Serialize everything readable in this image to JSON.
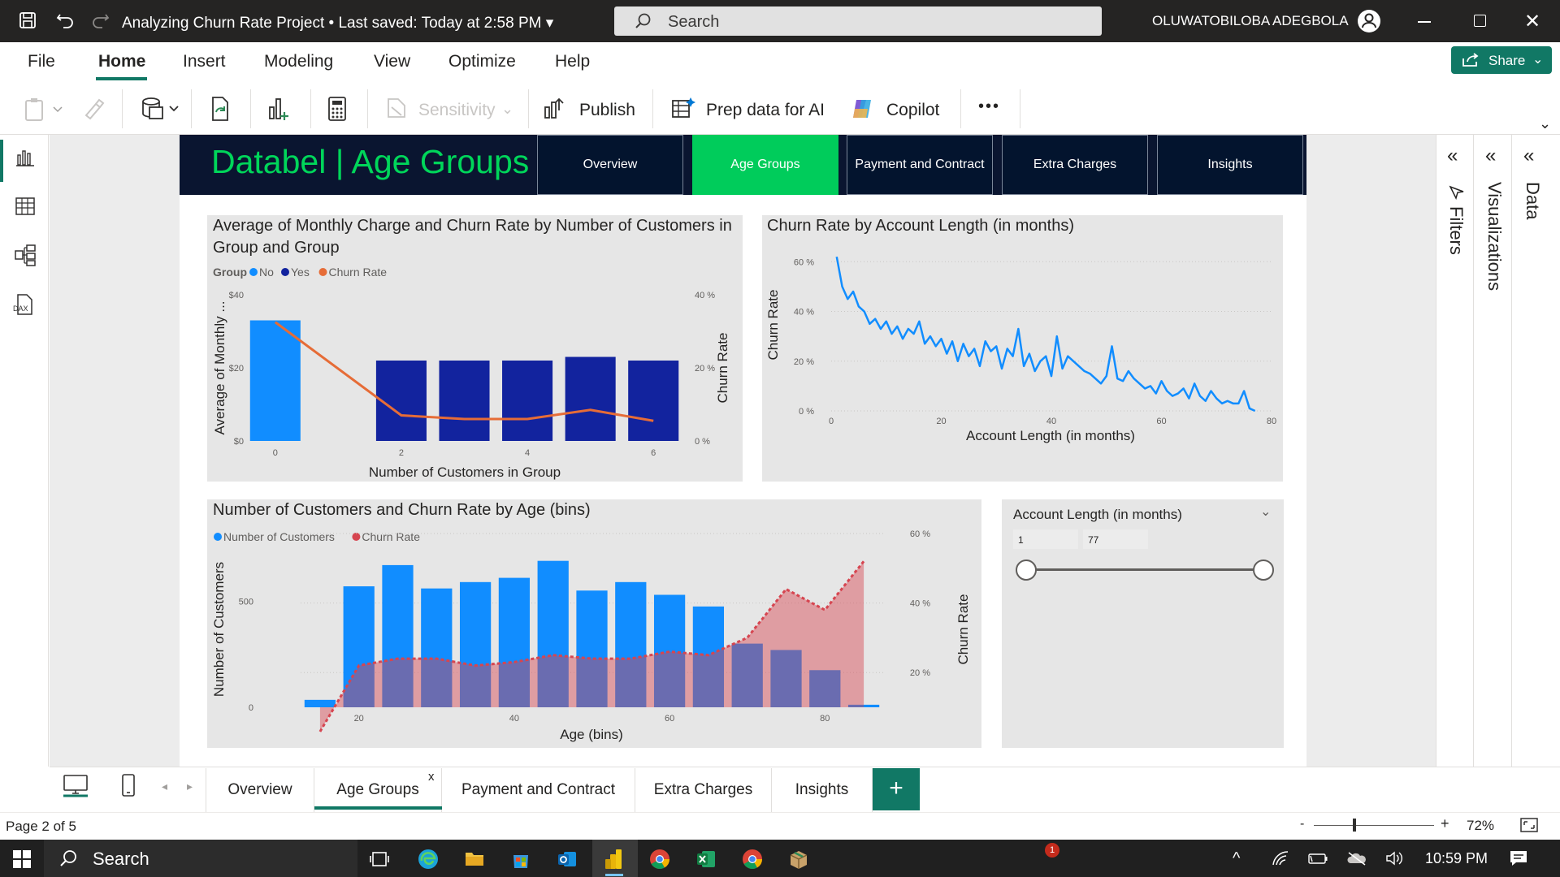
{
  "titlebar": {
    "document": "Analyzing Churn Rate Project",
    "saved": "Last saved: Today at 2:58 PM",
    "search_placeholder": "Search",
    "user": "OLUWATOBILOBA ADEGBOLA"
  },
  "menu": {
    "items": [
      "File",
      "Home",
      "Insert",
      "Modeling",
      "View",
      "Optimize",
      "Help"
    ],
    "share": "Share"
  },
  "ribbon": {
    "sensitivity": "Sensitivity",
    "publish": "Publish",
    "prep_data": "Prep data for AI",
    "copilot": "Copilot",
    "more": "•••"
  },
  "report": {
    "title": "Databel | Age Groups",
    "nav": [
      "Overview",
      "Age Groups",
      "Payment and Contract",
      "Extra Charges",
      "Insights"
    ],
    "active_nav": "Age Groups"
  },
  "chart_data": [
    {
      "type": "bar",
      "title": "Average of Monthly Charge and Churn Rate by Number of Customers in Group and Group",
      "legend_title": "Group",
      "legend": [
        "No",
        "Yes",
        "Churn Rate"
      ],
      "xlabel": "Number of Customers in Group",
      "ylabel": "Average of Monthly ...",
      "y2label": "Churn Rate",
      "x_ticks": [
        "0",
        "2",
        "4",
        "6"
      ],
      "y_ticks": [
        "$0",
        "$20",
        "$40"
      ],
      "y2_ticks": [
        "0 %",
        "20 %",
        "40 %"
      ],
      "categories": [
        0,
        2,
        3,
        4,
        5,
        6
      ],
      "series": [
        {
          "name": "No",
          "values": [
            33,
            null,
            null,
            null,
            null,
            null
          ],
          "color": "#118dff"
        },
        {
          "name": "Yes",
          "values": [
            null,
            22,
            22,
            22,
            23,
            22
          ],
          "color": "#12239e"
        },
        {
          "name": "Churn Rate",
          "values": [
            32.5,
            7,
            6,
            6,
            8.5,
            5.5
          ],
          "color": "#e66c37",
          "axis": "secondary",
          "kind": "line"
        }
      ],
      "ylim": [
        0,
        40
      ],
      "y2lim": [
        0,
        40
      ]
    },
    {
      "type": "line",
      "title": "Churn Rate by Account Length (in months)",
      "xlabel": "Account Length (in months)",
      "ylabel": "Churn Rate",
      "x_ticks": [
        "0",
        "20",
        "40",
        "60",
        "80"
      ],
      "y_ticks": [
        "0 %",
        "20 %",
        "40 %",
        "60 %"
      ],
      "xlim": [
        0,
        80
      ],
      "ylim": [
        0,
        65
      ],
      "color": "#118dff",
      "x": [
        1,
        2,
        3,
        4,
        5,
        6,
        7,
        8,
        9,
        10,
        11,
        12,
        13,
        14,
        15,
        16,
        17,
        18,
        19,
        20,
        21,
        22,
        23,
        24,
        25,
        26,
        27,
        28,
        29,
        30,
        31,
        32,
        33,
        34,
        35,
        36,
        37,
        38,
        39,
        40,
        41,
        42,
        43,
        44,
        45,
        46,
        47,
        48,
        49,
        50,
        51,
        52,
        53,
        54,
        55,
        56,
        57,
        58,
        59,
        60,
        61,
        62,
        63,
        64,
        65,
        66,
        67,
        68,
        69,
        70,
        71,
        72,
        73,
        74,
        75,
        76,
        77
      ],
      "y": [
        62,
        50,
        45,
        48,
        42,
        40,
        35,
        37,
        33,
        36,
        31,
        34,
        29,
        33,
        31,
        36,
        27,
        30,
        26,
        29,
        23,
        28,
        20,
        27,
        22,
        25,
        18,
        28,
        24,
        26,
        17,
        25,
        22,
        33,
        18,
        23,
        16,
        20,
        22,
        14,
        30,
        17,
        22,
        20,
        18,
        16,
        15,
        13,
        11,
        14,
        26,
        13,
        12,
        16,
        13,
        11,
        9,
        10,
        7,
        12,
        8,
        6,
        7,
        9,
        5,
        11,
        6,
        4,
        8,
        5,
        3,
        4,
        3,
        3,
        8,
        1,
        0
      ]
    },
    {
      "type": "bar",
      "title": "Number of Customers and Churn Rate by Age (bins)",
      "legend": [
        "Number of Customers",
        "Churn Rate"
      ],
      "xlabel": "Age (bins)",
      "ylabel": "Number of Customers",
      "y2label": "Churn Rate",
      "x_ticks": [
        "20",
        "40",
        "60",
        "80"
      ],
      "y_ticks": [
        "0",
        "500"
      ],
      "y2_ticks": [
        "20 %",
        "40 %",
        "60 %"
      ],
      "categories": [
        15,
        20,
        25,
        30,
        35,
        40,
        45,
        50,
        55,
        60,
        65,
        70,
        75,
        80,
        85
      ],
      "series": [
        {
          "name": "Number of Customers",
          "values": [
            35,
            570,
            670,
            560,
            590,
            610,
            690,
            550,
            590,
            530,
            475,
            300,
            270,
            175,
            12
          ],
          "color": "#118dff"
        },
        {
          "name": "Churn Rate",
          "values": [
            3,
            22,
            24,
            24,
            22,
            23,
            25,
            24,
            24,
            26,
            25,
            30,
            44,
            38,
            52
          ],
          "color": "#d64550",
          "axis": "secondary",
          "kind": "area"
        }
      ],
      "ylim": [
        0,
        750
      ],
      "y2lim": [
        10,
        60
      ]
    }
  ],
  "slicer": {
    "title": "Account Length (in months)",
    "min": "1",
    "max": "77"
  },
  "panes": [
    "Filters",
    "Visualizations",
    "Data"
  ],
  "tabs": [
    "Overview",
    "Age Groups",
    "Payment and Contract",
    "Extra Charges",
    "Insights"
  ],
  "active_tab": "Age Groups",
  "tab_close": "x",
  "status": {
    "page": "Page 2 of 5",
    "zoom": "72%"
  },
  "taskbar": {
    "search": "Search",
    "time": "10:59 PM",
    "badge": "1"
  }
}
